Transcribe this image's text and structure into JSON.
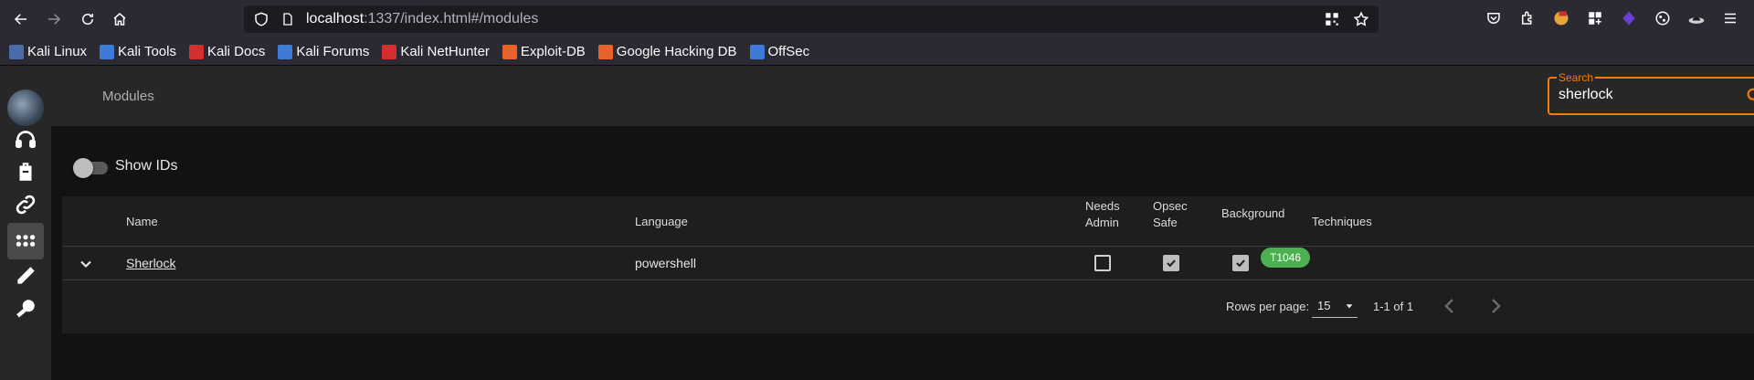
{
  "browser": {
    "url_host": "localhost",
    "url_rest": ":1337/index.html#/modules",
    "bookmarks": [
      {
        "label": "Kali Linux",
        "icon": "kali-dragon-icon",
        "color": "#4a6da8"
      },
      {
        "label": "Kali Tools",
        "icon": "kali-tools-icon",
        "color": "#3d7bd8"
      },
      {
        "label": "Kali Docs",
        "icon": "kali-docs-icon",
        "color": "#d32f2f"
      },
      {
        "label": "Kali Forums",
        "icon": "kali-forums-icon",
        "color": "#3d7bd8"
      },
      {
        "label": "Kali NetHunter",
        "icon": "nethunter-icon",
        "color": "#d32f2f"
      },
      {
        "label": "Exploit-DB",
        "icon": "exploit-db-icon",
        "color": "#e8632b"
      },
      {
        "label": "Google Hacking DB",
        "icon": "ghdb-icon",
        "color": "#e8632b"
      },
      {
        "label": "OffSec",
        "icon": "offsec-icon",
        "color": "#3d7bd8"
      }
    ]
  },
  "app": {
    "title": "Modules",
    "accent": "#f57c00",
    "search": {
      "label": "Search",
      "value": "sherlock"
    },
    "sidebar": [
      {
        "icon": "headphones-icon",
        "name": "listeners"
      },
      {
        "icon": "suitcase-icon",
        "name": "stagers"
      },
      {
        "icon": "link-icon",
        "name": "agents"
      },
      {
        "icon": "modules-grid-icon",
        "name": "modules",
        "active": true
      },
      {
        "icon": "pen-icon",
        "name": "plugins"
      },
      {
        "icon": "key-icon",
        "name": "credentials"
      }
    ],
    "show_ids_label": "Show IDs",
    "show_ids": false,
    "table": {
      "headers": {
        "name": "Name",
        "language": "Language",
        "needs_admin_1": "Needs",
        "needs_admin_2": "Admin",
        "opsec_1": "Opsec",
        "opsec_2": "Safe",
        "background": "Background",
        "techniques": "Techniques"
      },
      "rows": [
        {
          "name": "Sherlock",
          "language": "powershell",
          "needs_admin": false,
          "opsec_safe": true,
          "background": true,
          "technique": "T1046"
        }
      ]
    },
    "pagination": {
      "rows_per_page_label": "Rows per page:",
      "rows_per_page": "15",
      "range": "1-1 of 1"
    }
  }
}
